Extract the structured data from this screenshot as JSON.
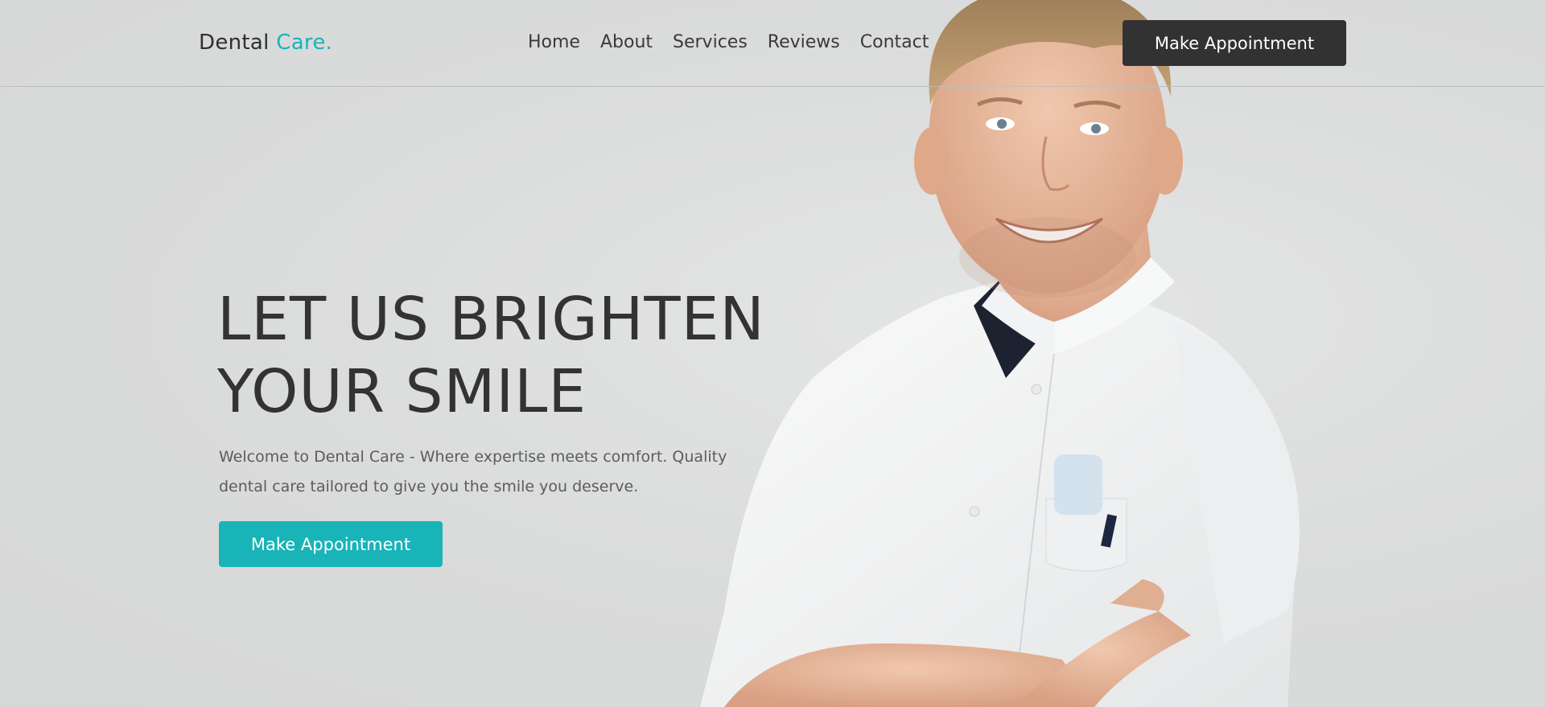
{
  "header": {
    "logo_main": "Dental",
    "logo_accent": "Care.",
    "nav": [
      "Home",
      "About",
      "Services",
      "Reviews",
      "Contact"
    ],
    "cta_label": "Make Appointment"
  },
  "hero": {
    "title_line1": "LET US BRIGHTEN",
    "title_line2": "YOUR SMILE",
    "description": "Welcome to Dental Care - Where expertise meets comfort. Quality dental care tailored to give you the smile you deserve.",
    "cta_label": "Make Appointment"
  },
  "colors": {
    "accent": "#18b3b8",
    "dark_button": "#323232",
    "background": "#dcdddd"
  },
  "images": {
    "hero_photo": "smiling-dentist-photo"
  }
}
